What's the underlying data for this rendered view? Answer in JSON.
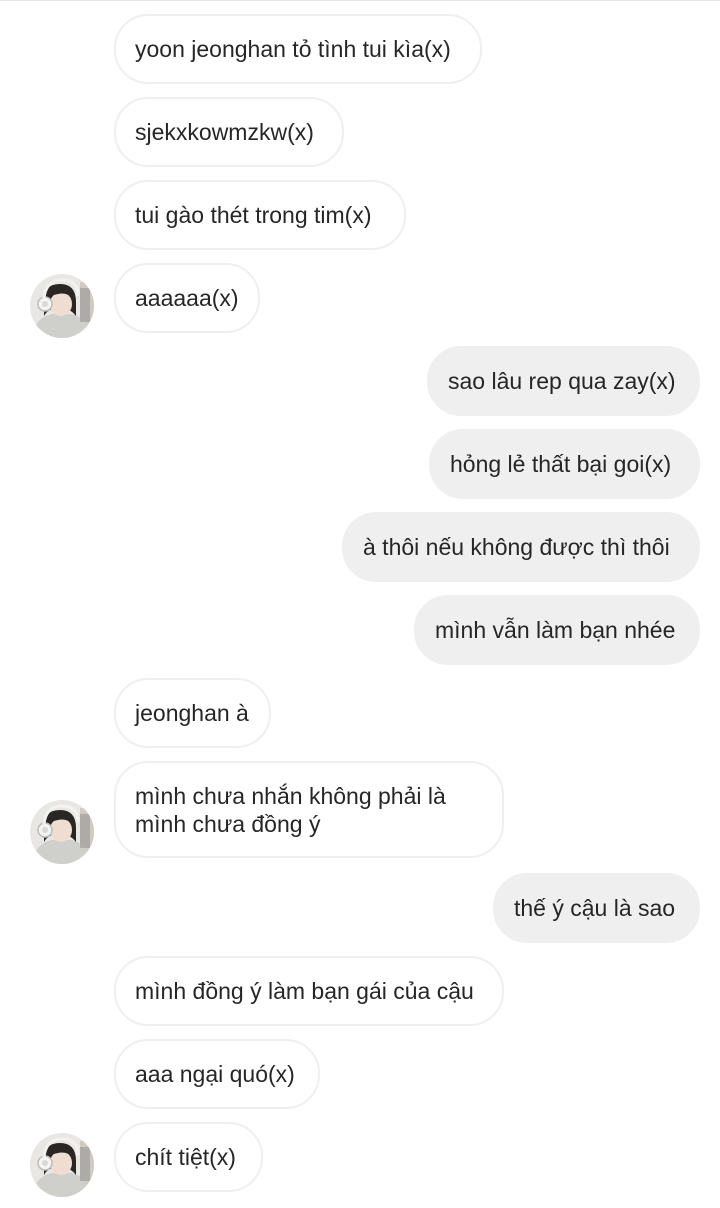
{
  "conversation": {
    "messages": [
      {
        "side": "in",
        "text": "yoon jeonghan tỏ tình tui kìa(x)"
      },
      {
        "side": "in",
        "text": "sjekxkowmzkw(x)"
      },
      {
        "side": "in",
        "text": "tui gào thét trong tim(x)"
      },
      {
        "side": "in",
        "text": "aaaaaa(x)"
      },
      {
        "side": "out",
        "text": "sao lâu rep qua zay(x)"
      },
      {
        "side": "out",
        "text": "hỏng lẻ thất bại goi(x)"
      },
      {
        "side": "out",
        "text": "à thôi nếu không được thì thôi"
      },
      {
        "side": "out",
        "text": "mình vẫn làm bạn nhée"
      },
      {
        "side": "in",
        "text": "jeonghan à"
      },
      {
        "side": "in",
        "text": "mình chưa nhắn không phải là mình chưa đồng ý"
      },
      {
        "side": "out",
        "text": "thế ý cậu là sao"
      },
      {
        "side": "in",
        "text": "mình đồng ý làm bạn gái của cậu"
      },
      {
        "side": "in",
        "text": "aaa ngại quó(x)"
      },
      {
        "side": "in",
        "text": "chít tiệt(x)"
      }
    ]
  },
  "contact": {
    "avatar_icon": "profile-photo-girl-with-headphones"
  },
  "colors": {
    "incoming_bubble_bg": "#ffffff",
    "incoming_bubble_border": "#efefef",
    "outgoing_bubble_bg": "#efefef",
    "text": "#262626"
  }
}
